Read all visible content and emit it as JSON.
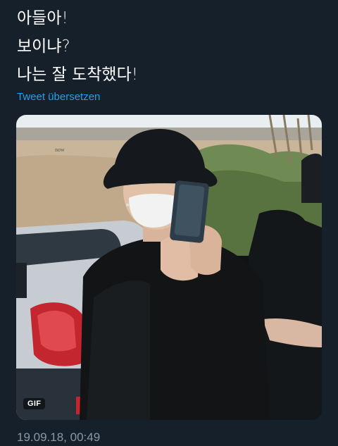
{
  "tweet": {
    "lines": [
      "아들아!",
      "보이냐?",
      "나는 잘 도착했다!"
    ],
    "translate_label": "Tweet übersetzen",
    "timestamp": "19.09.18, 00:49"
  },
  "media": {
    "type": "gif",
    "badge_label": "GIF",
    "watermark_text": "now"
  },
  "colors": {
    "background": "#15202b",
    "text": "#ffffff",
    "link": "#1da1f2",
    "meta": "#8899a6"
  }
}
